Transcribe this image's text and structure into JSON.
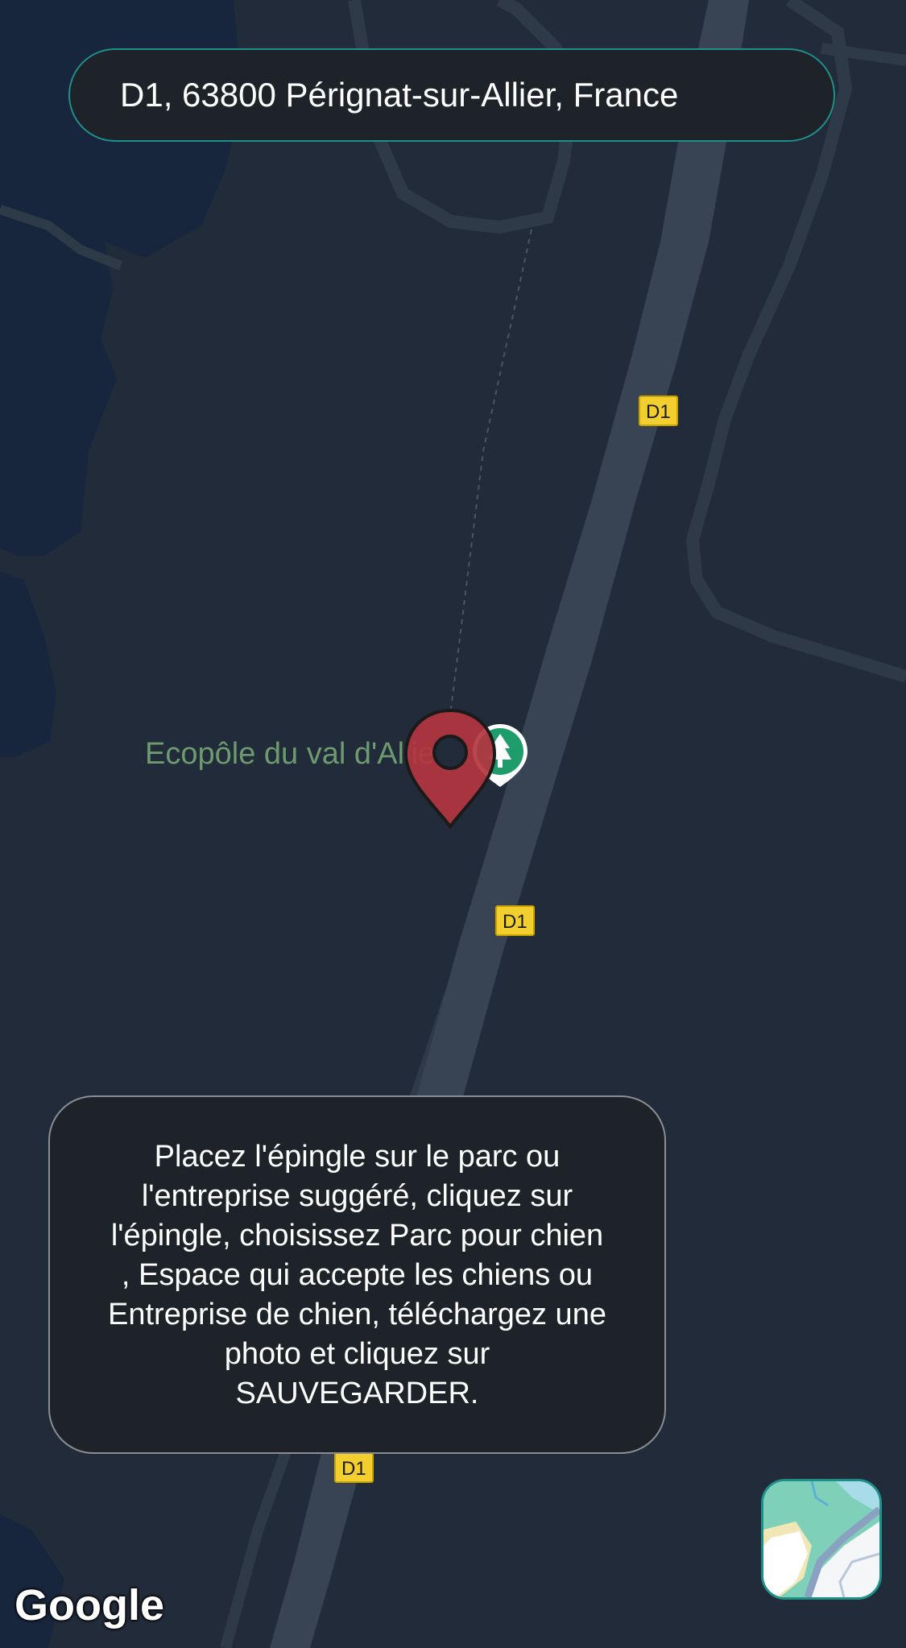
{
  "search": {
    "address": "D1, 63800 Pérignat-sur-Allier, France"
  },
  "map": {
    "road_shields": [
      "D1",
      "D1",
      "D1"
    ],
    "poi": {
      "label": "Ecopôle du val d'Allier",
      "icon": "park-tree-icon"
    },
    "pin_icon": "map-pin-icon",
    "colors": {
      "background": "#212b39",
      "water": "#17263c",
      "road": "#384353",
      "poi_label": "#6d9a6f",
      "poi_badge": "#1e9c6c",
      "pin": "#b3353f",
      "shield": "#f2cf2e",
      "accent": "#1f8f8a"
    }
  },
  "instructions": {
    "text": "Placez l'épingle sur le parc ou l'entreprise suggéré, cliquez sur l'épingle, choisissez Parc pour chien , Espace qui accepte les chiens ou Entreprise de chien, téléchargez une photo et cliquez sur SAUVEGARDER."
  },
  "attribution": {
    "logo_text": "Google"
  },
  "layers_button": {
    "icon": "map-layers-icon"
  }
}
